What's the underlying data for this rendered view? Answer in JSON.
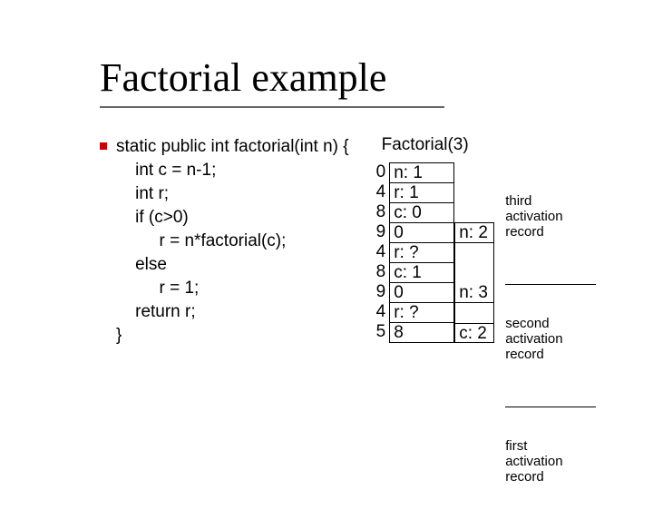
{
  "title": "Factorial example",
  "code": "static public int factorial(int n) {\n    int c = n-1;\n    int r;\n    if (c>0)\n         r = n*factorial(c);\n    else\n         r = 1;\n    return r;\n}",
  "call_label": "Factorial(3)",
  "left_numbers": "0\n4\n8\n9\n4\n8\n9\n4\n5",
  "record3": {
    "n": "n: 1",
    "r": "r: 1",
    "c": "c: 0",
    "label": "third\nactivation\nrecord"
  },
  "record2": {
    "ret": "0",
    "n": "n: 2",
    "r": "r: ?",
    "c": "c: 1",
    "label": "second\nactivation\nrecord"
  },
  "record1": {
    "ret": "0",
    "n": "n: 3",
    "r": "r: ?",
    "c_left": "8",
    "c_right": "c: 2",
    "label": "first\nactivation\nrecord"
  }
}
